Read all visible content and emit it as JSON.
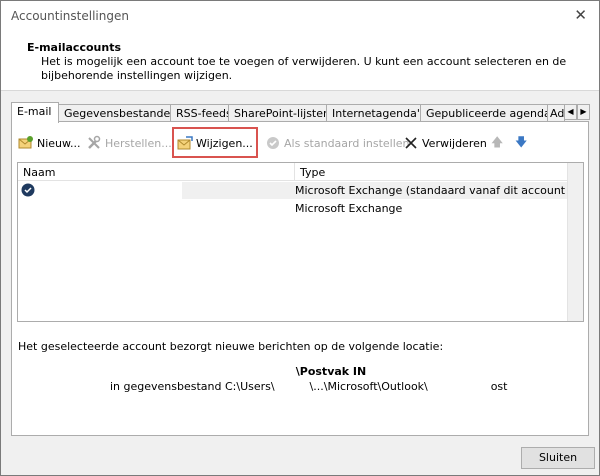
{
  "window": {
    "title": "Accountinstellingen",
    "close_glyph": "✕"
  },
  "header": {
    "title": "E-mailaccounts",
    "description": "Het is mogelijk een account toe te voegen of verwijderen. U kunt een account selecteren en de bijbehorende instellingen wijzigen."
  },
  "tabs": [
    {
      "label": "E-mail",
      "active": true
    },
    {
      "label": "Gegevensbestanden"
    },
    {
      "label": "RSS-feeds"
    },
    {
      "label": "SharePoint-lijsten"
    },
    {
      "label": "Internetagenda's"
    },
    {
      "label": "Gepubliceerde agenda's"
    },
    {
      "label": "Ad"
    }
  ],
  "tab_scroll": {
    "left": "◀",
    "right": "▶"
  },
  "toolbar": {
    "new_label": "Nieuw...",
    "repair_label": "Herstellen...",
    "change_label": "Wijzigen...",
    "default_label": "Als standaard instellen",
    "delete_label": "Verwijderen",
    "up_glyph": "🡅",
    "down_glyph": "🡇",
    "highlight_color": "#d9534f"
  },
  "list": {
    "columns": [
      "Naam",
      "Type"
    ],
    "rows": [
      {
        "name": "",
        "type": "Microsoft Exchange (standaard vanaf dit account ver...",
        "default": true,
        "selected": true
      },
      {
        "name": "",
        "type": "Microsoft Exchange",
        "default": false,
        "selected": false
      }
    ]
  },
  "delivery": {
    "info": "Het geselecteerde account bezorgt nieuwe berichten op de volgende locatie:",
    "folder": "\\Postvak IN",
    "path": "in gegevensbestand C:\\Users\\          \\...\\Microsoft\\Outlook\\                  ost"
  },
  "footer": {
    "close_label": "Sluiten"
  }
}
